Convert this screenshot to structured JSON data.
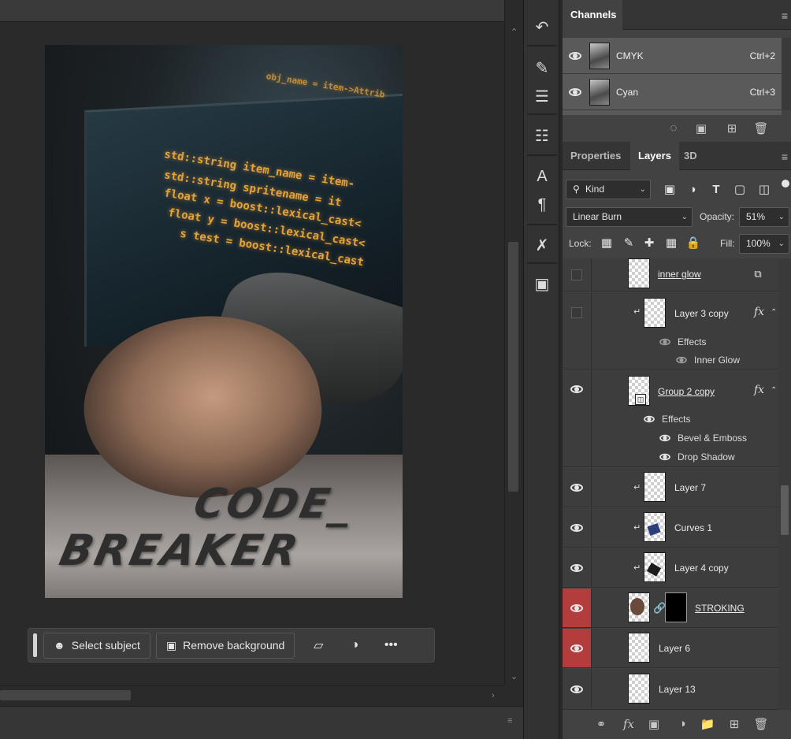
{
  "document": {
    "code_lines": [
      "obj_name = item->Attrib",
      "std::string item_name = item-",
      "std::string spritename = it",
      "float x = boost::lexical_cast<",
      "float y = boost::lexical_cast<",
      "s test = boost::lexical_cast"
    ],
    "title_line1": "CODE_",
    "title_line2": "BREAKER"
  },
  "contextual_bar": {
    "select_subject": "Select subject",
    "remove_background": "Remove background",
    "more": "•••"
  },
  "channels_panel": {
    "tab": "Channels",
    "rows": [
      {
        "name": "CMYK",
        "shortcut": "Ctrl+2"
      },
      {
        "name": "Cyan",
        "shortcut": "Ctrl+3"
      }
    ]
  },
  "layers_panel": {
    "tabs": [
      "Properties",
      "Layers",
      "3D"
    ],
    "active_tab": "Layers",
    "filter_kind": "Kind",
    "blend_mode": "Linear Burn",
    "opacity_label": "Opacity:",
    "opacity_value": "51%",
    "lock_label": "Lock:",
    "fill_label": "Fill:",
    "fill_value": "100%",
    "layers": [
      {
        "name": "inner glow",
        "visible": false
      },
      {
        "name": "Layer 3 copy",
        "visible": false,
        "effects": [
          "Effects",
          "Inner Glow"
        ]
      },
      {
        "name": "Group 2 copy",
        "visible": true,
        "effects": [
          "Effects",
          "Bevel & Emboss",
          "Drop Shadow"
        ]
      },
      {
        "name": "Layer 7",
        "visible": true
      },
      {
        "name": "Curves 1",
        "visible": true
      },
      {
        "name": "Layer 4 copy",
        "visible": true
      },
      {
        "name": "STROKING",
        "visible": true
      },
      {
        "name": "Layer 6",
        "visible": true
      },
      {
        "name": "Layer 13",
        "visible": true
      }
    ],
    "fx_symbol": "fx"
  },
  "icons": {
    "kind_filter": "search-icon",
    "strip": [
      "history-icon",
      "brush-settings-icon",
      "adjustments-icon",
      "clone-source-icon",
      "character-icon",
      "paragraph-icon",
      "tool-presets-icon",
      "artboard-icon"
    ]
  }
}
